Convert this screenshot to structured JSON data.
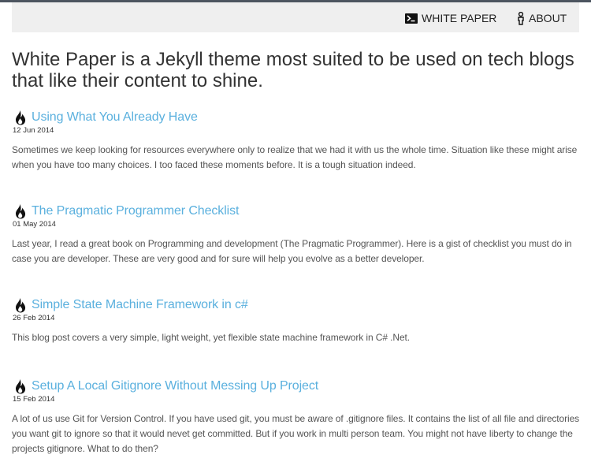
{
  "navbar": {
    "items": [
      {
        "label": "WHITE PAPER",
        "icon": "terminal-icon"
      },
      {
        "label": "ABOUT",
        "icon": "person-icon"
      }
    ]
  },
  "tagline": "White Paper is a Jekyll theme most suited to be used on tech blogs that like their content to shine.",
  "posts": [
    {
      "title": "Using What You Already Have",
      "date": "12 Jun 2014",
      "excerpt": "Sometimes we keep looking for resources everywhere only to realize that we had it with us the whole time. Situation like these might arise when you have too many choices. I too faced these moments before. It is a tough situation indeed.",
      "icon": "fire-icon"
    },
    {
      "title": "The Pragmatic Programmer Checklist",
      "date": "01 May 2014",
      "excerpt": "Last year, I read a great book on Programming and development (The Pragmatic Programmer). Here is a gist of checklist you must do in case you are developer. These are very good and for sure will help you evolve as a better developer.",
      "icon": "fire-icon"
    },
    {
      "title": "Simple State Machine Framework in c#",
      "date": "26 Feb 2014",
      "excerpt": "This blog post covers a very simple, light weight, yet flexible state machine framework in C# .Net.",
      "icon": "fire-icon"
    },
    {
      "title": "Setup A Local Gitignore Without Messing Up Project",
      "date": "15 Feb 2014",
      "excerpt": "A lot of us use Git for Version Control. If you have used git, you must be aware of .gitignore files. It contains the list of all file and directories you want git to ignore so that it would nevet get committed. But if you work in multi person team. You might not have liberty to change the projects gitignore. What to do then?",
      "icon": "fire-icon"
    }
  ],
  "colors": {
    "link": "#5ab0de",
    "navbar_bg": "#efefef",
    "top_border": "#4d5560"
  }
}
